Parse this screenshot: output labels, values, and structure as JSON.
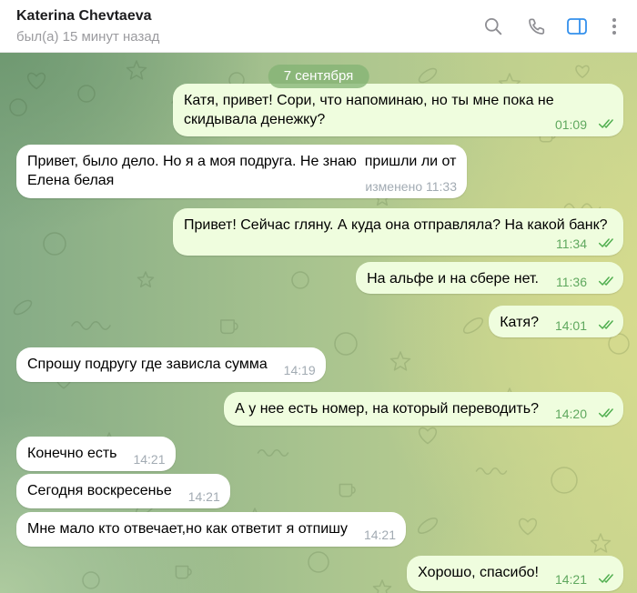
{
  "header": {
    "contact_name": "Katerina Chevtaeva",
    "last_seen": "был(а) 15 минут назад",
    "icons": {
      "search": "search-icon",
      "call": "phone-icon",
      "sidebar": "sidebar-toggle-icon",
      "more": "more-vertical-icon"
    }
  },
  "chat": {
    "date_separator": "7 сентября",
    "messages": [
      {
        "outgoing": true,
        "text": "Катя, привет! Сори, что напоминаю, но ты мне пока не скидывала денежку?",
        "time": "01:09",
        "receipt_icon": "double-check-icon"
      },
      {
        "outgoing": false,
        "text": "Привет, было дело. Но я а моя подруга. Не знаю  пришли ли от Елена белая",
        "edited": "изменено",
        "time": "11:33"
      },
      {
        "outgoing": true,
        "text": "Привет! Сейчас гляну. А куда она отправляла? На какой банк?",
        "time": "11:34",
        "receipt_icon": "double-check-icon"
      },
      {
        "outgoing": true,
        "text": "На альфе и на сбере нет.",
        "time": "11:36",
        "receipt_icon": "double-check-icon"
      },
      {
        "outgoing": true,
        "text": "Катя?",
        "time": "14:01",
        "receipt_icon": "double-check-icon"
      },
      {
        "outgoing": false,
        "text": "Спрошу подругу где зависла сумма",
        "time": "14:19"
      },
      {
        "outgoing": true,
        "text": "А у нее есть номер, на который переводить?",
        "time": "14:20",
        "receipt_icon": "double-check-icon"
      },
      {
        "outgoing": false,
        "text": "Конечно есть",
        "time": "14:21"
      },
      {
        "outgoing": false,
        "text": "Сегодня воскресенье",
        "time": "14:21"
      },
      {
        "outgoing": false,
        "text": "Мне мало кто отвечает,но как ответит я отпишу",
        "time": "14:21"
      },
      {
        "outgoing": true,
        "text": "Хорошо, спасибо!",
        "time": "14:21",
        "receipt_icon": "double-check-icon"
      }
    ]
  },
  "colors": {
    "outgoing_bubble": "#effdde",
    "incoming_bubble": "#ffffff",
    "accent": "#3390ec",
    "read_check": "#4fae4e",
    "outgoing_time": "#5fa85e",
    "incoming_time": "#a2abb3"
  }
}
